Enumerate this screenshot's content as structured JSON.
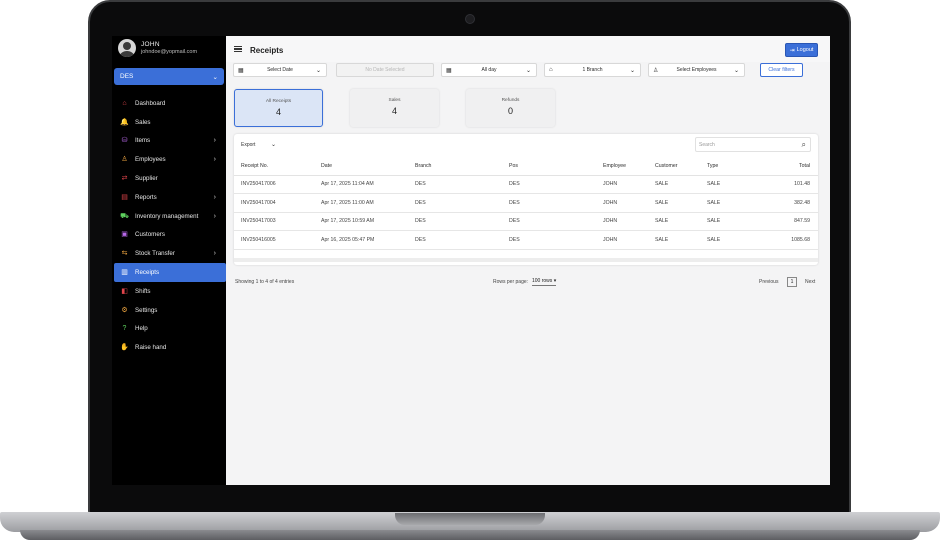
{
  "user": {
    "name": "JOHN",
    "email": "johndoe@yopmail.com"
  },
  "branch_select": {
    "value": "DES"
  },
  "sidebar": {
    "items": [
      {
        "label": "Dashboard",
        "icon": "home-icon",
        "color": "#e0444b",
        "chevron": false
      },
      {
        "label": "Sales",
        "icon": "bell-icon",
        "color": "#5fd35f",
        "chevron": false
      },
      {
        "label": "Items",
        "icon": "basket-icon",
        "color": "#b768e8",
        "chevron": true
      },
      {
        "label": "Employees",
        "icon": "person-icon",
        "color": "#f0a640",
        "chevron": true
      },
      {
        "label": "Supplier",
        "icon": "swap-icon",
        "color": "#e0444b",
        "chevron": false
      },
      {
        "label": "Reports",
        "icon": "report-icon",
        "color": "#e0444b",
        "chevron": true
      },
      {
        "label": "Inventory management",
        "icon": "cart-icon",
        "color": "#5fd35f",
        "chevron": true
      },
      {
        "label": "Customers",
        "icon": "customers-icon",
        "color": "#b768e8",
        "chevron": false
      },
      {
        "label": "Stock Transfer",
        "icon": "transfer-icon",
        "color": "#f0a640",
        "chevron": true
      },
      {
        "label": "Receipts",
        "icon": "receipt-icon",
        "color": "#e0444b",
        "chevron": false,
        "active": true
      },
      {
        "label": "Shifts",
        "icon": "shift-icon",
        "color": "#e0444b",
        "chevron": false
      },
      {
        "label": "Settings",
        "icon": "gear-icon",
        "color": "#f0a640",
        "chevron": false
      },
      {
        "label": "Help",
        "icon": "help-icon",
        "color": "#5fd35f",
        "chevron": false
      },
      {
        "label": "Raise hand",
        "icon": "hand-icon",
        "color": "#b768e8",
        "chevron": false
      }
    ]
  },
  "header": {
    "title": "Receipts",
    "logout_label": "Logout"
  },
  "filters": {
    "date": "Select Date",
    "date_placeholder": "No Date Selected",
    "time": "All day",
    "branch": "1 Branch",
    "employees": "Select Employees",
    "clear": "Clear filters"
  },
  "cards": [
    {
      "label": "All Receipts",
      "value": "4"
    },
    {
      "label": "Sales",
      "value": "4"
    },
    {
      "label": "Refunds",
      "value": "0"
    }
  ],
  "table": {
    "export_label": "Export",
    "search_placeholder": "Search",
    "columns": [
      "Receipt No.",
      "Date",
      "Branch",
      "Pos",
      "Employee",
      "Customer",
      "Type",
      "Total"
    ],
    "rows": [
      [
        "INV250417006",
        "Apr 17, 2025 11:04 AM",
        "DES",
        "DES",
        "JOHN",
        "SALE",
        "SALE",
        "101.48"
      ],
      [
        "INV250417004",
        "Apr 17, 2025 11:00 AM",
        "DES",
        "DES",
        "JOHN",
        "SALE",
        "SALE",
        "382.48"
      ],
      [
        "INV250417003",
        "Apr 17, 2025 10:59 AM",
        "DES",
        "DES",
        "JOHN",
        "SALE",
        "SALE",
        "847.59"
      ],
      [
        "INV250416005",
        "Apr 16, 2025 05:47 PM",
        "DES",
        "DES",
        "JOHN",
        "SALE",
        "SALE",
        "1085.68"
      ]
    ]
  },
  "pagination": {
    "info": "Showing 1 to 4 of 4 entries",
    "rows_per_page_label": "Rows per page:",
    "rows_per_page_value": "100 rows",
    "previous": "Previous",
    "page": "1",
    "next": "Next"
  }
}
